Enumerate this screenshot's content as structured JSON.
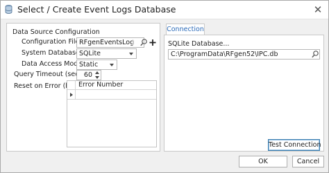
{
  "window": {
    "title": "Select / Create Event Logs Database"
  },
  "data_source": {
    "group_label": "Data Source Configuration",
    "configuration_file": {
      "label": "Configuration File",
      "value": "RFgenEventsLog"
    },
    "system_database": {
      "label": "System Database",
      "value": "SQLite"
    },
    "data_access_mode": {
      "label": "Data Access Mode",
      "value": "Static"
    },
    "query_timeout": {
      "label": "Query Timeout (sec)",
      "value": "60"
    },
    "reset_on_error": {
      "label": "Reset on Error (hex)",
      "column_header": "Error Number"
    }
  },
  "connection": {
    "tab_label": "Connection",
    "db_label": "SQLite Database...",
    "db_path": "C:\\ProgramData\\RFgen52\\IPC.db",
    "test_button": "Test Connection"
  },
  "footer": {
    "ok_label": "OK",
    "cancel_label": "Cancel"
  },
  "icons": {
    "app": "database-icon",
    "close": "close-icon",
    "search": "search-icon",
    "add": "plus-icon"
  }
}
